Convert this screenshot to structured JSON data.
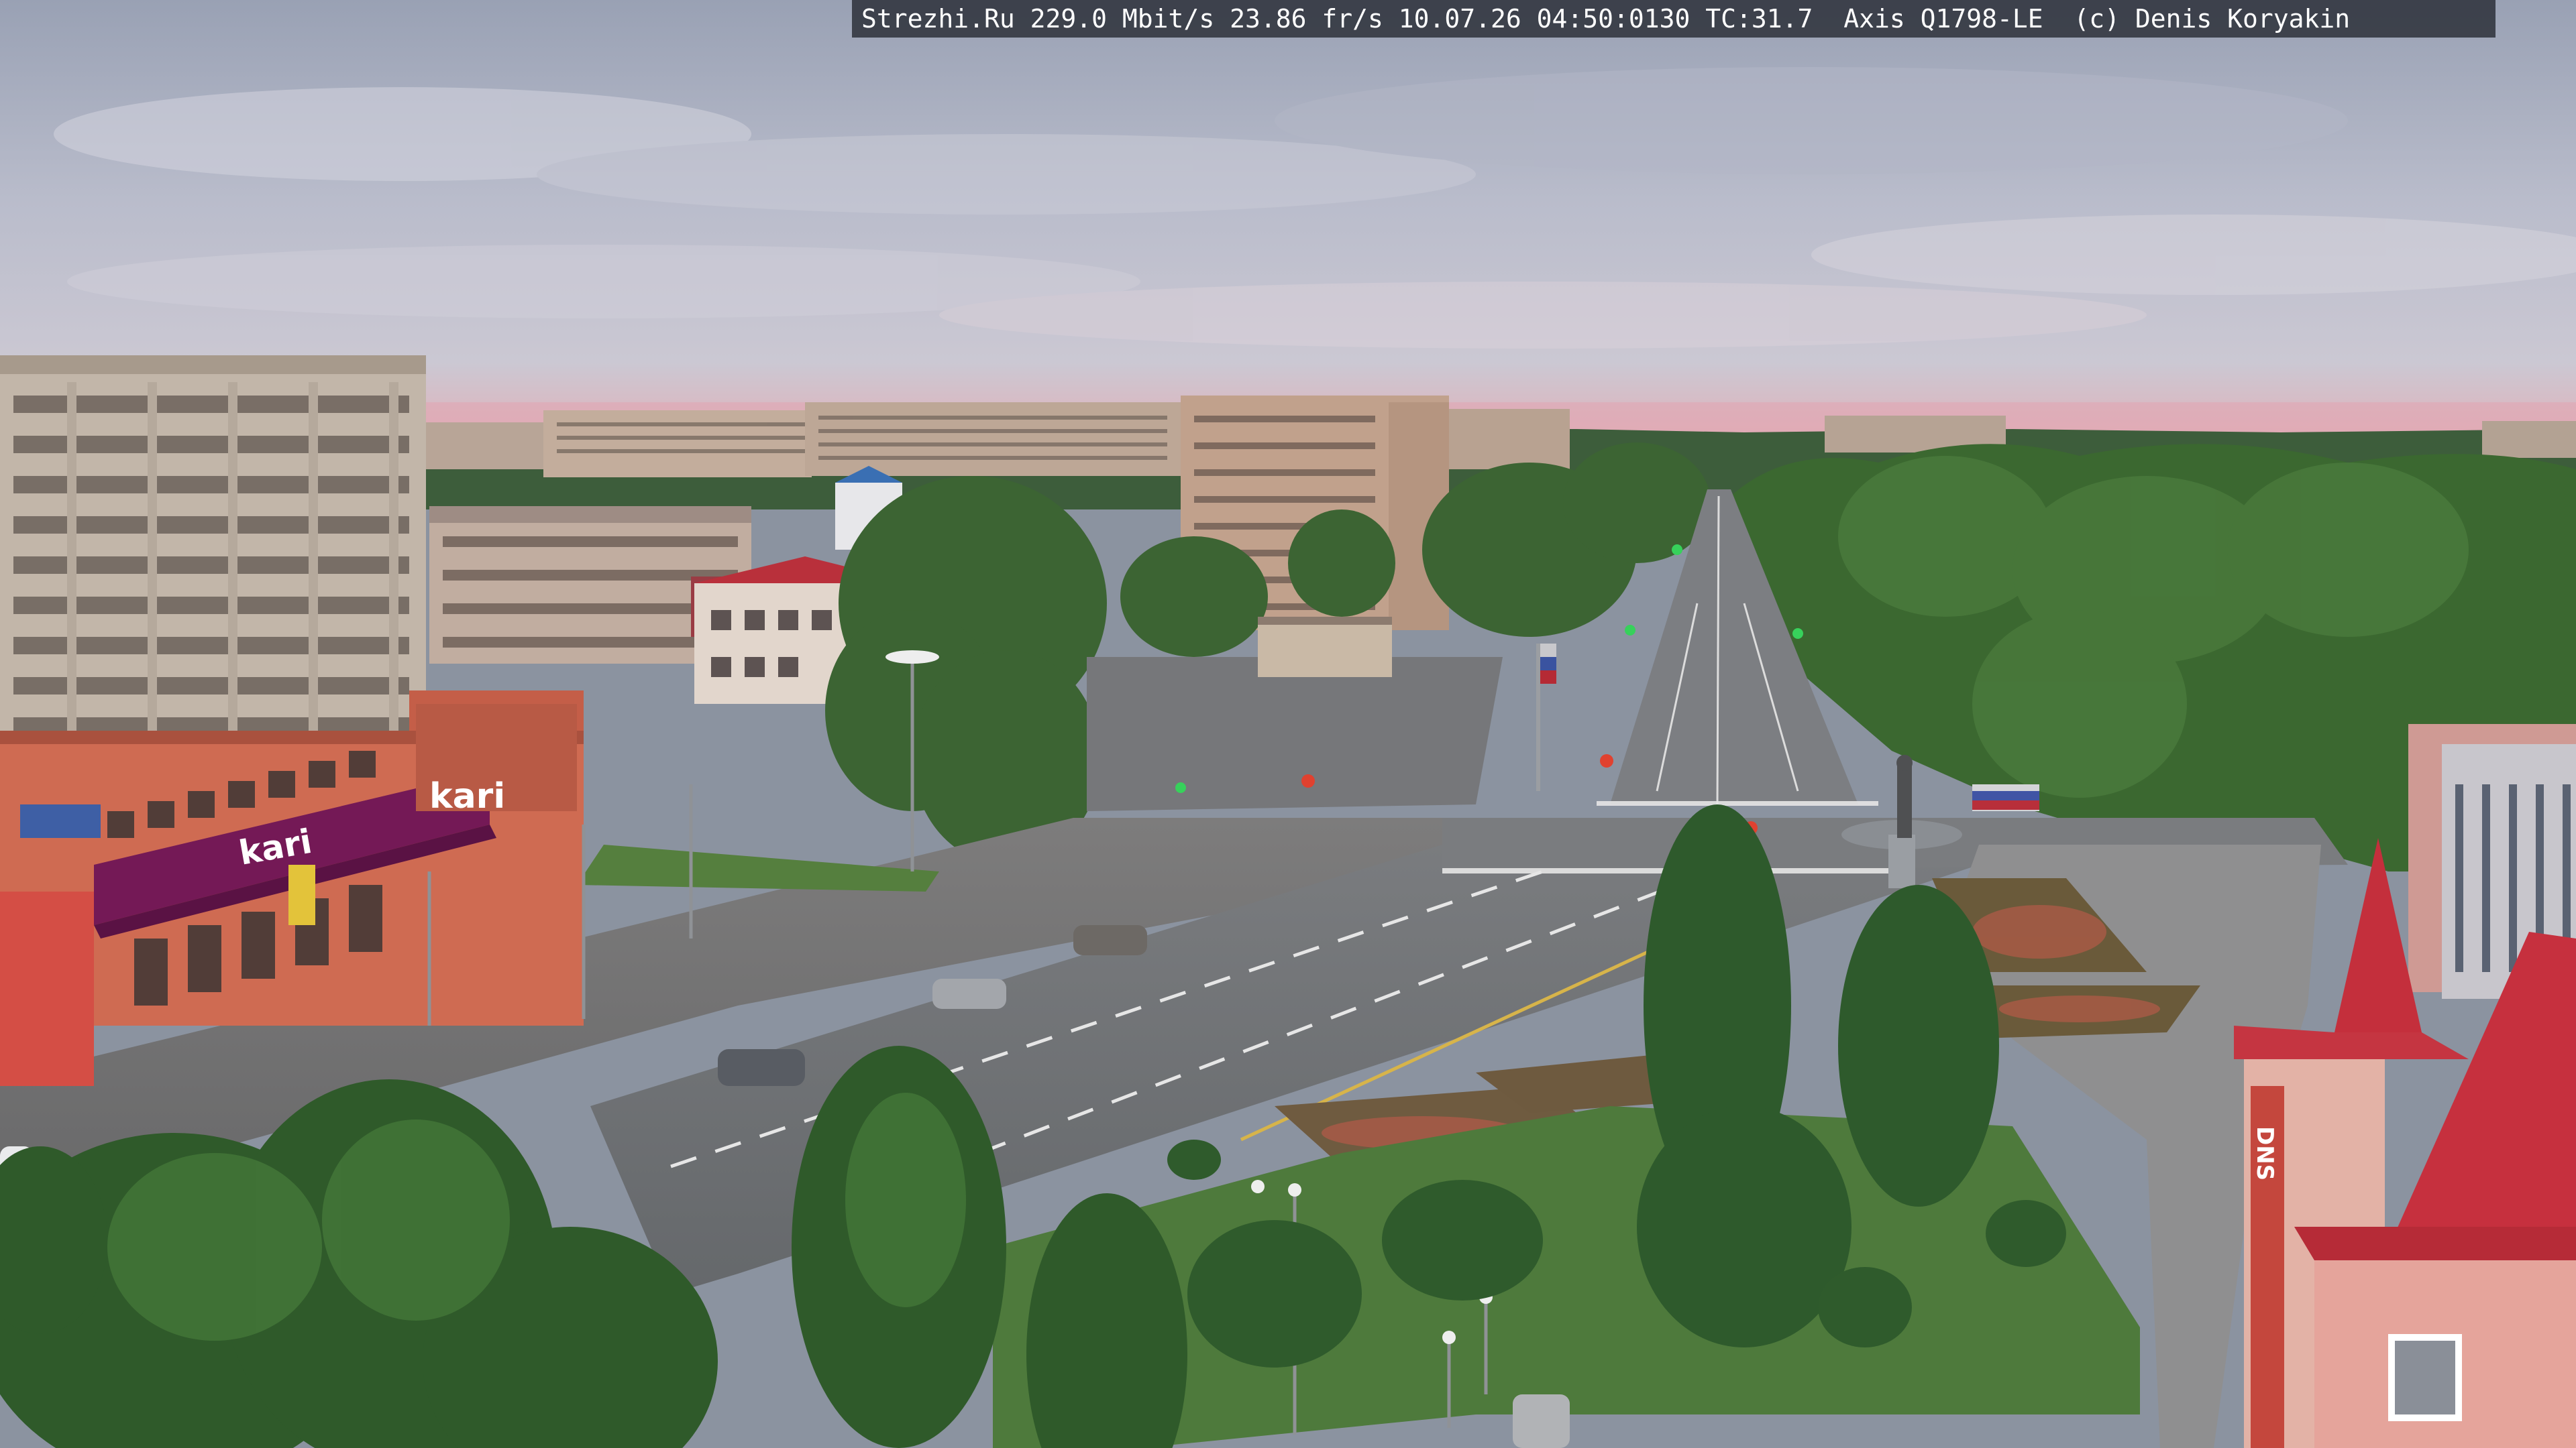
{
  "overlay": {
    "text": "Strezhi.Ru 229.0 Mbit/s 23.86 fr/s 10.07.26 04:50:0130 TC:31.7  Axis Q1798-LE  (c) Denis Koryakin"
  },
  "signs": {
    "kari_top": "kari",
    "kari_front": "kari",
    "dns": "DNS"
  },
  "colors": {
    "sky_top": "#a6adbd",
    "sky_mid": "#c2c5d2",
    "horizon_glow": "#e5a9b3",
    "forest": "#3f6a35",
    "road": "#6f7275",
    "roof_red": "#c3323a",
    "kari_purple": "#7a1a5a"
  }
}
